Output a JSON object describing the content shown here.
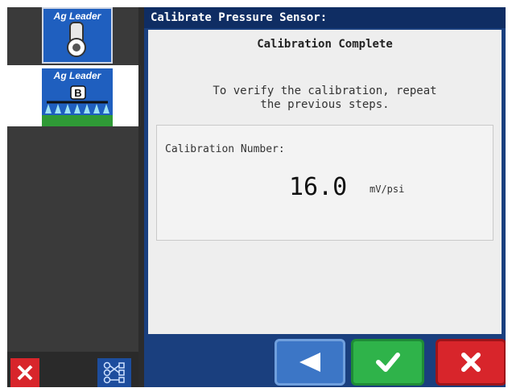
{
  "sidebar": {
    "tiles": [
      {
        "brand": "Ag Leader",
        "icon": "toggle-switch-icon"
      },
      {
        "brand": "Ag Leader",
        "icon": "boom-sprayer-icon",
        "badge": "B"
      }
    ],
    "close_icon": "close-icon",
    "network_icon": "network-icon"
  },
  "dialog": {
    "title": "Calibrate Pressure Sensor:",
    "heading": "Calibration Complete",
    "message_line1": "To verify the calibration, repeat",
    "message_line2": "the previous steps.",
    "calibration_label": "Calibration Number:",
    "calibration_value": "16.0",
    "calibration_unit": "mV/psi"
  },
  "buttons": {
    "back_icon": "arrow-left-icon",
    "ok_icon": "checkmark-icon",
    "cancel_icon": "cancel-icon"
  },
  "colors": {
    "title_bar": "#0f2d63",
    "accent_blue": "#1f5fbf",
    "ok_green": "#2fb34a",
    "cancel_red": "#d8252b"
  }
}
